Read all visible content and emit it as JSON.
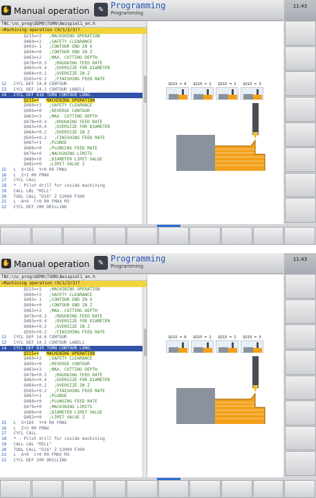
{
  "header": {
    "mode_manual": "Manual operation",
    "mode_programming": "Programming",
    "mode_programming_sub": "Programming",
    "clock": "11:43"
  },
  "program": {
    "path": "TNC:\\nc_prog\\DEMO\\TURN\\Beispiel1_en.h",
    "prompt": "→Machining operation (0/1/2/3)?",
    "lines": [
      {
        "num": "",
        "code": "Q215=+2",
        "comment": ";MACHINING OPERATION"
      },
      {
        "num": "",
        "code": "Q460=+2",
        "comment": ";SAFETY CLEARANCE"
      },
      {
        "num": "",
        "code": "Q493=-1",
        "comment": ";CONTOUR END IN X"
      },
      {
        "num": "",
        "code": "Q494=+0",
        "comment": ";CONTOUR END IN Z"
      },
      {
        "num": "",
        "code": "Q463=+2",
        "comment": ";MAX. CUTTING DEPTH"
      },
      {
        "num": "",
        "code": "Q478=+0.3",
        "comment": ";ROUGHING FEED RATE"
      },
      {
        "num": "",
        "code": "Q483=+0.4",
        "comment": ";OVERSIZE FOR DIAMETER"
      },
      {
        "num": "",
        "code": "Q484=+0.2",
        "comment": ";OVERSIZE IN Z"
      },
      {
        "num": "",
        "code": "Q505=+0.2",
        "comment": ";FINISHING FEED RATE"
      },
      {
        "num": "12",
        "code": "CYCL DEF 14.0 CONTOUR",
        "comment": ""
      },
      {
        "num": "13",
        "code": "CYCL DEF 14.1 CONTOUR LABEL1",
        "comment": ""
      },
      {
        "num": "14",
        "code": "CYCL DEF 810 TURN CONTOUR LONG.",
        "comment": "",
        "selected": true
      },
      {
        "num": "",
        "code": "Q215=+",
        "comment": "MACHINING OPERATION",
        "highlight": true
      },
      {
        "num": "",
        "code": "Q460=+2",
        "comment": ";SAFETY CLEARANCE"
      },
      {
        "num": "",
        "code": "Q499=+0",
        "comment": ";REVERSE CONTOUR"
      },
      {
        "num": "",
        "code": "Q463=+3",
        "comment": ";MAX. CUTTING DEPTH"
      },
      {
        "num": "",
        "code": "Q478=+0.3",
        "comment": ";ROUGHING FEED RATE"
      },
      {
        "num": "",
        "code": "Q483=+0.4",
        "comment": ";OVERSIZE FOR DIAMETER"
      },
      {
        "num": "",
        "code": "Q484=+0.2",
        "comment": ";OVERSIZE IN Z"
      },
      {
        "num": "",
        "code": "Q505=+0.2",
        "comment": ";FINISHING FEED RATE"
      },
      {
        "num": "",
        "code": "Q487=+1",
        "comment": ";PLUNGE"
      },
      {
        "num": "",
        "code": "Q488=+0",
        "comment": ";PLUNGING FEED RATE"
      },
      {
        "num": "",
        "code": "Q479=+0",
        "comment": ";MACHINING LIMITS"
      },
      {
        "num": "",
        "code": "Q480=+0",
        "comment": ";DIAMETER LIMIT VALUE"
      },
      {
        "num": "",
        "code": "Q482=+0",
        "comment": ";LIMIT VALUE Z"
      },
      {
        "num": "15",
        "code": "L  X+165  Y+0 R0 FMAX",
        "comment": ""
      },
      {
        "num": "16",
        "code": "L  Z+2 R0 FMAX",
        "comment": ""
      },
      {
        "num": "17",
        "code": "CYCL CALL",
        "comment": ""
      },
      {
        "num": "18",
        "code": "* - Pilot drill for inside machining",
        "comment": ""
      },
      {
        "num": "19",
        "code": "CALL LBL \"MILL\"",
        "comment": ""
      },
      {
        "num": "20",
        "code": "TOOL CALL \"D16\" Z S2000 F300",
        "comment": ""
      },
      {
        "num": "21",
        "code": "L  A+0  C+0 R0 FMAX M3",
        "comment": ""
      },
      {
        "num": "22",
        "code": "CYCL DEF 200 DRILLING",
        "comment": ""
      }
    ]
  },
  "graphics": {
    "variants": [
      "Q215 = 0",
      "Q215 = 1",
      "Q215 = 2",
      "Q215 = 3"
    ],
    "colors": {
      "workpiece": "#8a929e",
      "contour": "#f3a11a",
      "tool": "#4a4f57"
    }
  }
}
